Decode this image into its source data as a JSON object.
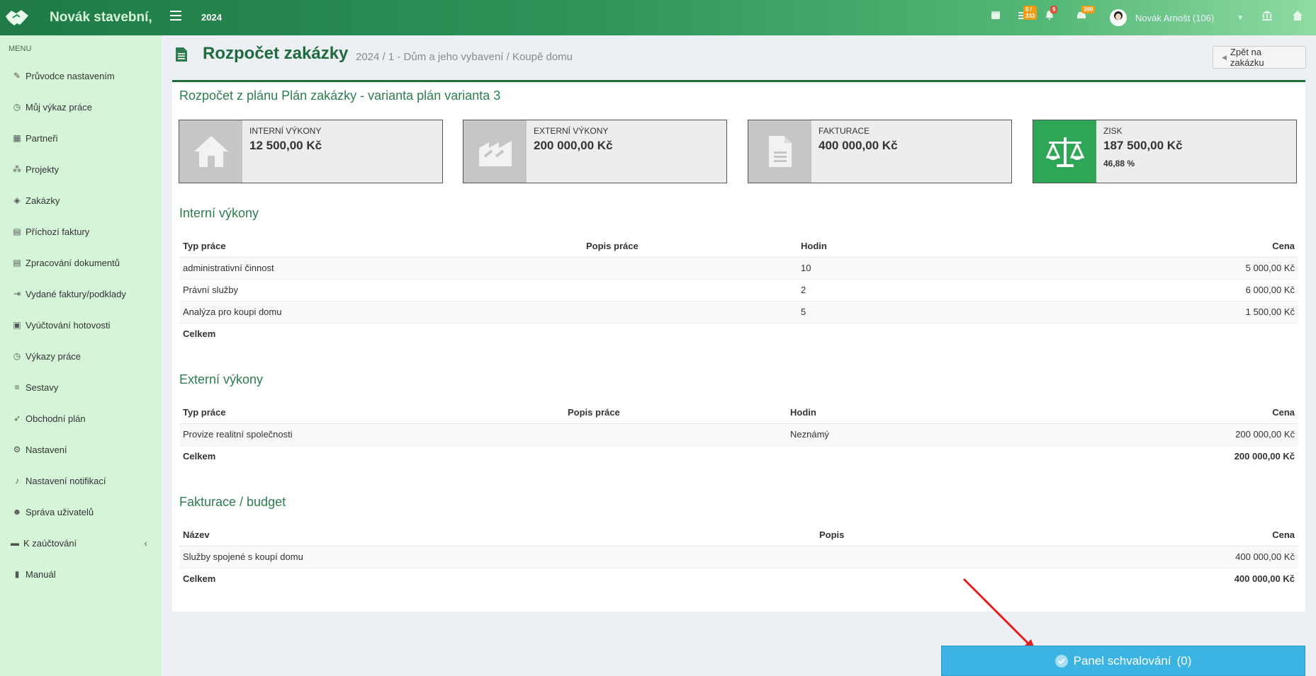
{
  "header": {
    "brand": "Novák stavební,",
    "year": "2024",
    "badges": {
      "tasks": "0 / 333",
      "notifications": "9",
      "cars": "399"
    },
    "user_name": "Novák Arnošt (106)"
  },
  "sidebar": {
    "menu_label": "MENU",
    "items": [
      {
        "label": "Průvodce nastavením",
        "icon": "pencil-icon"
      },
      {
        "label": "Můj výkaz práce",
        "icon": "clock-icon"
      },
      {
        "label": "Partneři",
        "icon": "building-icon"
      },
      {
        "label": "Projekty",
        "icon": "cubes-icon"
      },
      {
        "label": "Zakázky",
        "icon": "cube-icon"
      },
      {
        "label": "Příchozí faktury",
        "icon": "file-icon"
      },
      {
        "label": "Zpracování dokumentů",
        "icon": "file-text-icon"
      },
      {
        "label": "Vydané faktury/podklady",
        "icon": "sign-out-icon"
      },
      {
        "label": "Vyúčtování hotovosti",
        "icon": "money-icon"
      },
      {
        "label": "Výkazy práce",
        "icon": "clock-icon"
      },
      {
        "label": "Sestavy",
        "icon": "chart-icon"
      },
      {
        "label": "Obchodní plán",
        "icon": "rocket-icon"
      },
      {
        "label": "Nastavení",
        "icon": "gears-icon"
      },
      {
        "label": "Nastavení notifikací",
        "icon": "bell-icon"
      },
      {
        "label": "Správa uživatelů",
        "icon": "users-icon"
      },
      {
        "label": "K zaúčtování",
        "icon": "folder-icon"
      },
      {
        "label": "Manuál",
        "icon": "book-icon"
      }
    ]
  },
  "page": {
    "title": "Rozpočet zakázky",
    "breadcrumb": "2024 / 1 - Dům a jeho vybavení / Koupě domu",
    "back_label": "Zpět na zakázku",
    "panel_title": "Rozpočet z plánu Plán zakázky - varianta plán varianta 3"
  },
  "summary": [
    {
      "label": "INTERNÍ VÝKONY",
      "value": "12 500,00 Kč",
      "icon": "home-icon"
    },
    {
      "label": "EXTERNÍ VÝKONY",
      "value": "200 000,00 Kč",
      "icon": "industry-icon"
    },
    {
      "label": "FAKTURACE",
      "value": "400 000,00 Kč",
      "icon": "document-icon"
    },
    {
      "label": "ZISK",
      "value": "187 500,00 Kč",
      "sub": "46,88 %",
      "icon": "balance-scale-icon"
    }
  ],
  "internal": {
    "title": "Interní výkony",
    "headers": [
      "Typ práce",
      "Popis práce",
      "Hodin",
      "Cena"
    ],
    "rows": [
      [
        "administrativní činnost",
        "",
        "10",
        "5 000,00 Kč"
      ],
      [
        "Právní služby",
        "",
        "2",
        "6 000,00 Kč"
      ],
      [
        "Analýza pro koupi domu",
        "",
        "5",
        "1 500,00 Kč"
      ]
    ],
    "total_label": "Celkem",
    "total_value": ""
  },
  "external": {
    "title": "Externí výkony",
    "headers": [
      "Typ práce",
      "Popis práce",
      "Hodin",
      "Cena"
    ],
    "rows": [
      [
        "Provize realitní společnosti",
        "",
        "Neznámý",
        "200 000,00 Kč"
      ]
    ],
    "total_label": "Celkem",
    "total_value": "200 000,00 Kč"
  },
  "invoicing": {
    "title": "Fakturace / budget",
    "headers": [
      "Název",
      "Popis",
      "Cena"
    ],
    "rows": [
      [
        "Služby spojené s koupí domu",
        "",
        "400 000,00 Kč"
      ]
    ],
    "total_label": "Celkem",
    "total_value": "400 000,00 Kč"
  },
  "approval": {
    "label": "Panel schvalování",
    "count": "(0)"
  },
  "colors": {
    "accent": "#1f6b3d",
    "sidebar": "#d5f5d9",
    "approval": "#3bb3e3",
    "profit": "#2ea655"
  }
}
